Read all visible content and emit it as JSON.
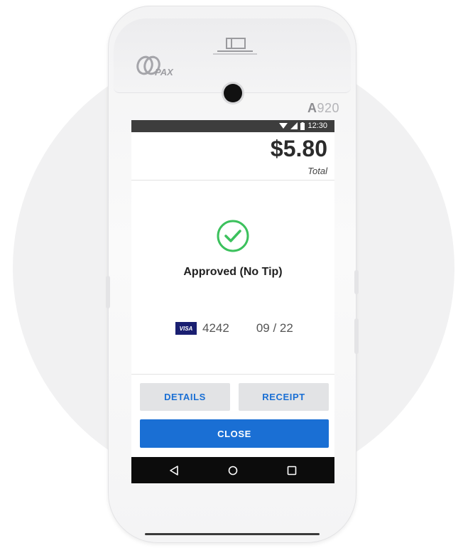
{
  "device": {
    "brand": "PAX",
    "model_prefix": "A",
    "model_number": "920"
  },
  "status_bar": {
    "time": "12:30",
    "icons": [
      "wifi-icon",
      "signal-icon",
      "battery-icon"
    ]
  },
  "transaction": {
    "amount": "$5.80",
    "amount_label": "Total",
    "status_text": "Approved (No Tip)",
    "status_icon": "check-circle-icon",
    "card_brand": "VISA",
    "card_last4": "4242",
    "card_expiry": "09 / 22"
  },
  "actions": {
    "details_label": "DETAILS",
    "receipt_label": "RECEIPT",
    "close_label": "CLOSE"
  },
  "nav": {
    "buttons": [
      "back-icon",
      "home-icon",
      "recents-icon"
    ]
  },
  "colors": {
    "primary": "#1a6fd4",
    "success": "#3cc15d",
    "visa": "#1a1f71",
    "status_bar": "#3d3d3d",
    "nav_bar": "#0c0c0c"
  }
}
